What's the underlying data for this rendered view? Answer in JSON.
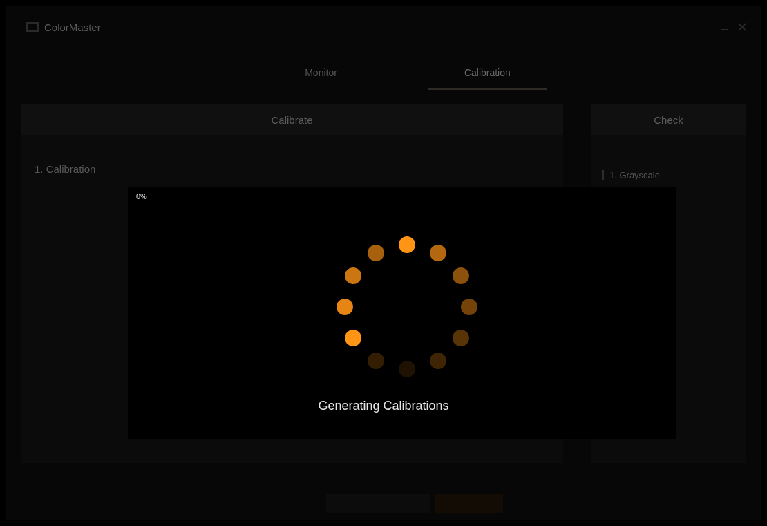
{
  "window": {
    "title": "ColorMaster"
  },
  "tabs": [
    {
      "label": "Monitor",
      "selected": false
    },
    {
      "label": "Calibration",
      "selected": true
    }
  ],
  "main_panel": {
    "header": "Calibrate",
    "section": "1. Calibration"
  },
  "side_panel": {
    "header": "Check",
    "items": [
      {
        "label": "1. Grayscale",
        "selected": true
      }
    ]
  },
  "loading_dialog": {
    "progress": "0%",
    "message": "Generating Calibrations"
  }
}
